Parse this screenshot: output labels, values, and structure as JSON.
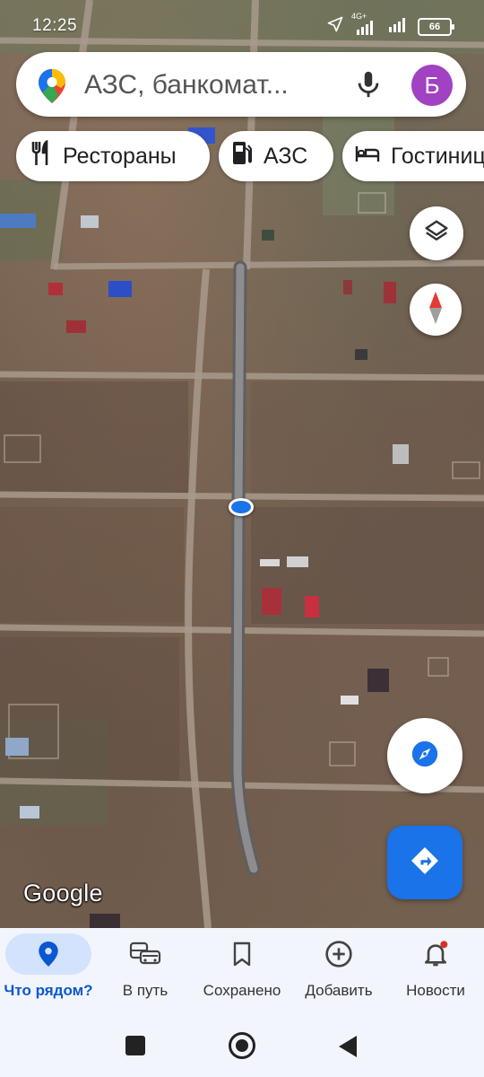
{
  "status_bar": {
    "time": "12:25",
    "network": "4G+",
    "battery": "66"
  },
  "search": {
    "placeholder": "АЗС, банкомат..."
  },
  "account": {
    "initial": "Б",
    "color": "#a142c2"
  },
  "chips": [
    {
      "label": "Рестораны",
      "icon": "fork-knife-icon"
    },
    {
      "label": "АЗС",
      "icon": "gas-station-icon"
    },
    {
      "label": "Гостиницы",
      "icon": "bed-icon"
    }
  ],
  "map": {
    "attribution": "Google",
    "layer_type": "satellite"
  },
  "bottom_nav": [
    {
      "label": "Что рядом?",
      "icon": "location-pin-icon",
      "active": true
    },
    {
      "label": "В путь",
      "icon": "commute-icon",
      "active": false
    },
    {
      "label": "Сохранено",
      "icon": "bookmark-icon",
      "active": false
    },
    {
      "label": "Добавить",
      "icon": "add-circle-icon",
      "active": false
    },
    {
      "label": "Новости",
      "icon": "bell-icon",
      "active": false,
      "badge": true
    }
  ],
  "colors": {
    "accent": "#1a73e8",
    "active_nav": "#0b57d0",
    "badge": "#d93025"
  }
}
